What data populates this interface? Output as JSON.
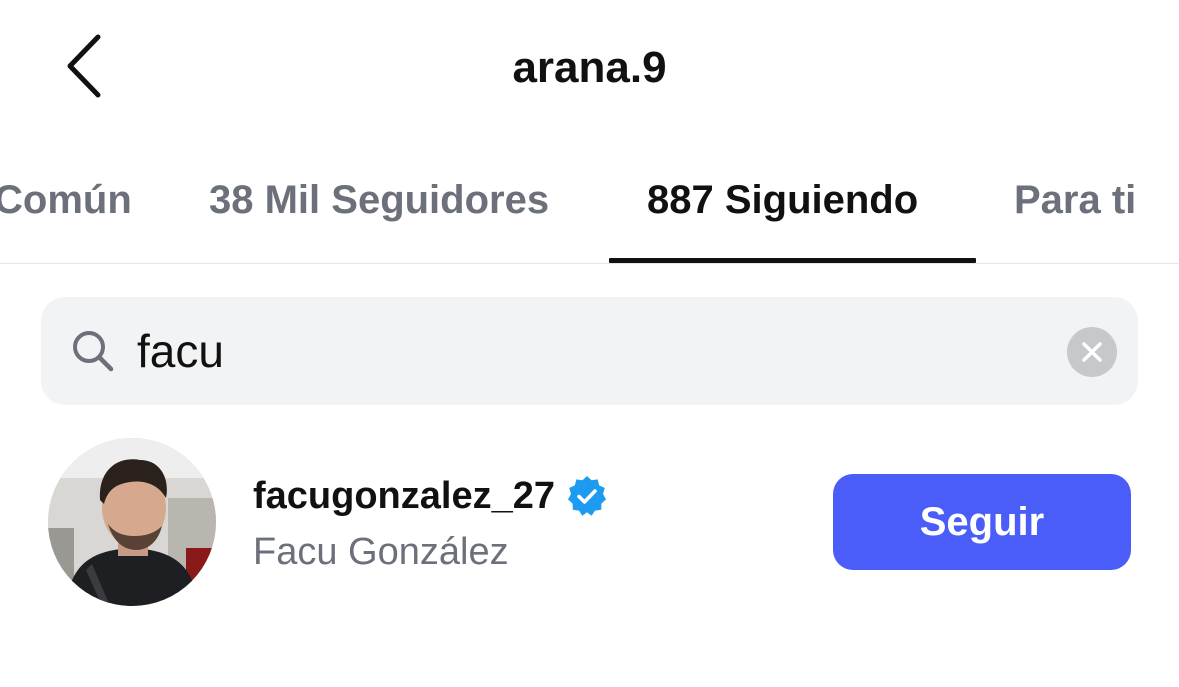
{
  "header": {
    "title": "arana.9",
    "back_icon": "chevron-left-icon"
  },
  "tabs": [
    {
      "label": "Común",
      "active": false
    },
    {
      "label": "38 Mil Seguidores",
      "active": false
    },
    {
      "label": "887 Siguiendo",
      "active": true
    },
    {
      "label": "Para ti",
      "active": false
    }
  ],
  "search": {
    "value": "facu",
    "icon": "search-icon",
    "clear_icon": "clear-icon"
  },
  "results": [
    {
      "username": "facugonzalez_27",
      "verified": true,
      "full_name": "Facu González",
      "follow_label": "Seguir"
    }
  ],
  "colors": {
    "accent": "#4a5df9",
    "verified": "#1d9bf0",
    "muted_text": "#6b707a",
    "search_bg": "#f2f3f5"
  }
}
